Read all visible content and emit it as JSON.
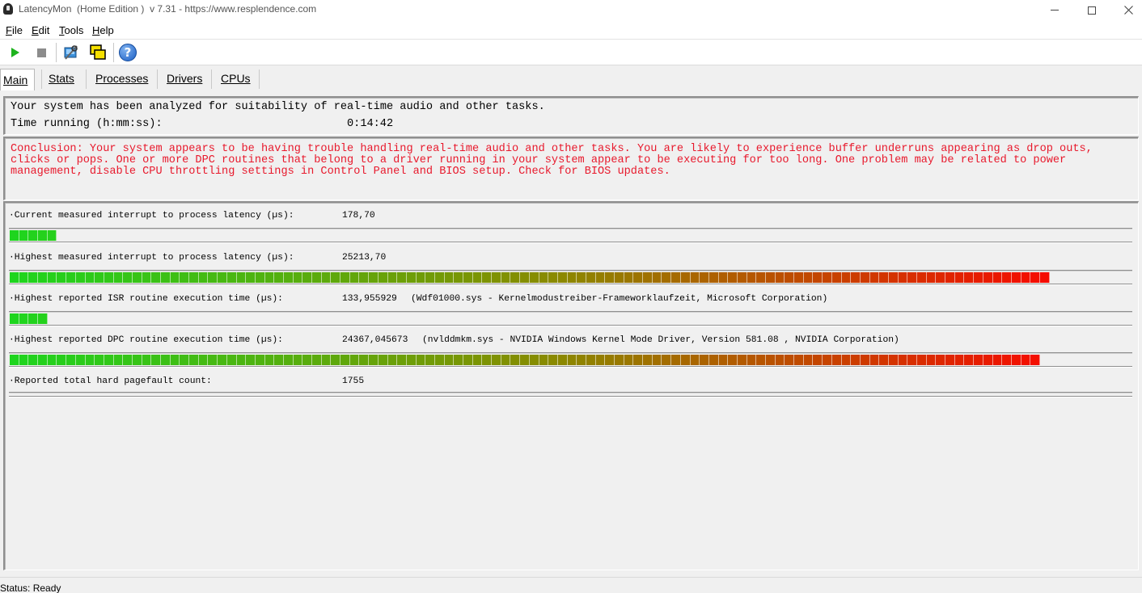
{
  "window": {
    "title": "LatencyMon  (Home Edition )  v 7.31 - https://www.resplendence.com"
  },
  "menu": [
    "File",
    "Edit",
    "Tools",
    "Help"
  ],
  "toolbar": {
    "icons": [
      "play-icon",
      "stop-icon",
      "find-driver-icon",
      "windows-icon",
      "help-icon"
    ]
  },
  "tabs": [
    "Main",
    "Stats",
    "Processes",
    "Drivers",
    "CPUs"
  ],
  "summary": {
    "line1": "Your system has been analyzed for suitability of real-time audio and other tasks.",
    "time_label": "Time running (h:mm:ss):",
    "time_value": "0:14:42"
  },
  "conclusion": {
    "text": "Conclusion: Your system appears to be having trouble handling real-time audio and other tasks. You are likely to experience buffer underruns appearing as drop outs, clicks or pops. One or more DPC routines that belong to a driver running in your system appear to be executing for too long. One problem may be related to power management, disable CPU throttling settings in Control Panel and BIOS setup. Check for BIOS updates.",
    "color": "#e8192c"
  },
  "metrics": [
    {
      "label": "·Current measured interrupt to process latency (µs):",
      "value": "178,70",
      "detail": "",
      "bar_fraction": 0.046
    },
    {
      "label": "·Highest measured interrupt to process latency (µs):",
      "value": "25213,70",
      "detail": "",
      "bar_fraction": 0.96
    },
    {
      "label": "·Highest reported ISR routine execution time (µs):",
      "value": "133,955929",
      "detail": "(Wdf01000.sys - Kernelmodustreiber-Frameworklaufzeit, Microsoft Corporation)",
      "bar_fraction": 0.034
    },
    {
      "label": "·Highest reported DPC routine execution time (µs):",
      "value": "24367,045673",
      "detail": "(nvlddmkm.sys - NVIDIA Windows Kernel Mode Driver, Version 581.08 , NVIDIA Corporation)",
      "bar_fraction": 0.952
    },
    {
      "label": "·Reported total hard pagefault count:",
      "value": "1755",
      "detail": "",
      "bar_fraction": 0
    }
  ],
  "status": {
    "text": "Status: Ready"
  },
  "colors": {
    "bar_start": "#1ed51e",
    "bar_mid": "#8a8a00",
    "bar_end": "#ff0000"
  }
}
